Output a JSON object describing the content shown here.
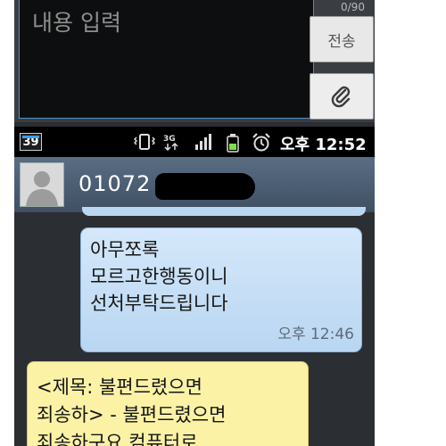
{
  "compose": {
    "placeholder": "내용 입력",
    "counter": "0/90",
    "send_label": "전송",
    "attach_icon": "paperclip-icon"
  },
  "statusbar": {
    "notification_count": "39",
    "icons": [
      "vibrate-icon",
      "3g-icon",
      "signal-icon",
      "battery-icon",
      "alarm-icon"
    ],
    "time": "오후 12:52"
  },
  "contact": {
    "number_visible": "01072",
    "avatar_icon": "person-icon"
  },
  "messages": [
    {
      "direction": "sent",
      "lines": [
        "아무쪼록",
        "모르고한행동이니",
        "선처부탁드립니다"
      ],
      "time": "오후 12:46"
    },
    {
      "direction": "received",
      "lines": [
        "<제목: 불편드렸으면",
        "죄송하> - 불편드렸으면",
        "죄송하구요 컴퓨터로"
      ]
    }
  ],
  "colors": {
    "sent_bubble": "#c8e0f7",
    "received_bubble": "#fbf2a6",
    "header": "#4d5f74",
    "accent": "#4a90c8"
  }
}
